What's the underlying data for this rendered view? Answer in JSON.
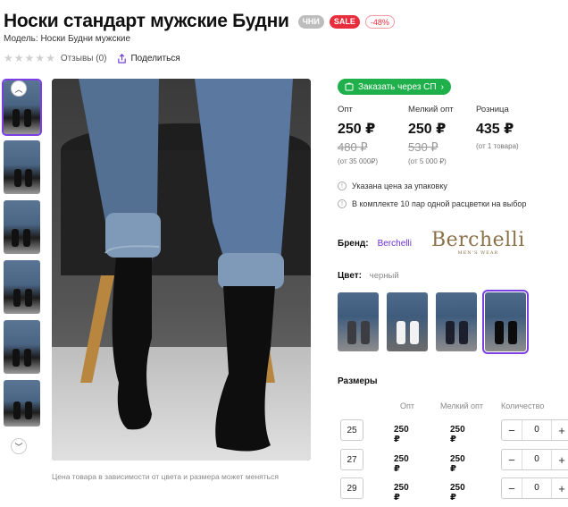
{
  "product": {
    "title": "Носки стандарт мужские Будни",
    "badges": {
      "chi": "ЧНИ",
      "sale": "SALE",
      "discount": "-48%"
    },
    "model": "Модель: Носки Будни мужские",
    "rating": {
      "stars": 5,
      "filled": 0
    },
    "reviews": "Отзывы (0)",
    "share": "Поделиться"
  },
  "gallery": {
    "caption": "Цена товара в зависимости от цвета и размера может меняться",
    "icons": {
      "up": "chevron-up-icon",
      "down": "chevron-down-icon"
    }
  },
  "order": {
    "label": "Заказать через СП",
    "icon": "cart-icon"
  },
  "prices": [
    {
      "label": "Опт",
      "current": "250 ₽",
      "old": "480 ₽",
      "note": "(от 35 000₽)"
    },
    {
      "label": "Мелкий опт",
      "current": "250 ₽",
      "old": "530 ₽",
      "note": "(от 5 000 ₽)"
    },
    {
      "label": "Розница",
      "current": "435 ₽",
      "old": "",
      "note": "(от 1 товара)"
    }
  ],
  "info": [
    "Указана цена за упаковку",
    "В комплекте 10 пар одной расцветки на выбор"
  ],
  "brand": {
    "label": "Бренд:",
    "name": "Berchelli",
    "logo_text": "Berchelli",
    "logo_sub": "MEN'S WEAR"
  },
  "color": {
    "label": "Цвет:",
    "value": "черный",
    "accent": "#7b3fe4"
  },
  "sizes": {
    "title": "Размеры",
    "headers": [
      "Опт",
      "Мелкий опт",
      "Количество"
    ],
    "rows": [
      {
        "size": "25",
        "opt": "250 ₽",
        "small_opt": "250 ₽",
        "qty": "0"
      },
      {
        "size": "27",
        "opt": "250 ₽",
        "small_opt": "250 ₽",
        "qty": "0"
      },
      {
        "size": "29",
        "opt": "250 ₽",
        "small_opt": "250 ₽",
        "qty": "0"
      }
    ],
    "minus": "−",
    "plus": "+"
  }
}
